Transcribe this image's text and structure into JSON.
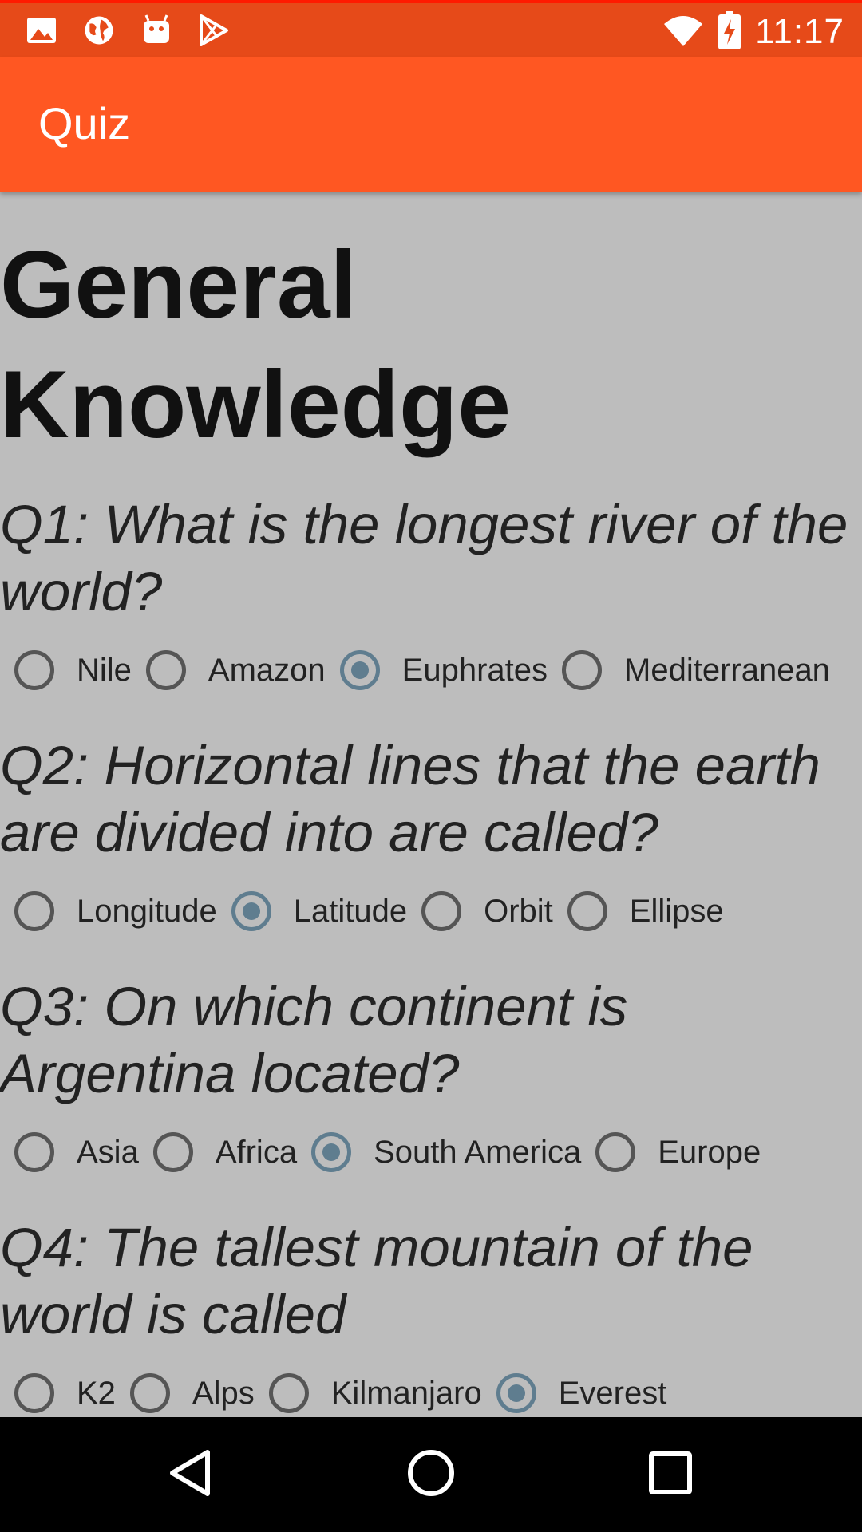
{
  "status_bar": {
    "time": "11:17",
    "icons": [
      "image-icon",
      "globe-icon",
      "android-icon",
      "play-store-icon",
      "wifi-icon",
      "battery-charging-icon"
    ],
    "color": "#e64a19"
  },
  "app_bar": {
    "title": "Quiz",
    "color": "#ff5722"
  },
  "main": {
    "title": "General Knowledge",
    "questions": [
      {
        "text": "Q1: What is the longest river of the world?",
        "options": [
          "Nile",
          "Amazon",
          "Euphrates",
          "Mediterranean"
        ],
        "selected": "Euphrates"
      },
      {
        "text": "Q2: Horizontal lines that the earth are divided into are called?",
        "options": [
          "Longitude",
          "Latitude",
          "Orbit",
          "Ellipse"
        ],
        "selected": "Latitude"
      },
      {
        "text": "Q3: On which continent is Argentina located?",
        "options": [
          "Asia",
          "Africa",
          "South America",
          "Europe"
        ],
        "selected": "South America"
      },
      {
        "text": "Q4: The tallest mountain of the world is called",
        "options": [
          "K2",
          "Alps",
          "Kilmanjaro",
          "Everest"
        ],
        "selected": "Everest"
      }
    ]
  },
  "nav_bar": {
    "buttons": [
      "back-icon",
      "home-icon",
      "recents-icon"
    ]
  },
  "colors": {
    "background": "#bdbdbd",
    "radio_checked": "#5f7d8f"
  }
}
